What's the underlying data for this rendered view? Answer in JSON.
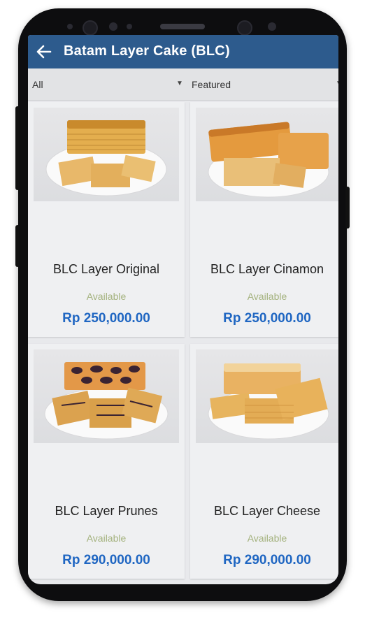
{
  "header": {
    "title": "Batam Layer Cake (BLC)"
  },
  "filters": {
    "category": "All",
    "sort": "Featured"
  },
  "products": [
    {
      "name": "BLC Layer Original",
      "availability": "Available",
      "price": "Rp 250,000.00"
    },
    {
      "name": "BLC Layer Cinamon",
      "availability": "Available",
      "price": "Rp 250,000.00"
    },
    {
      "name": "BLC Layer Prunes",
      "availability": "Available",
      "price": "Rp 290,000.00"
    },
    {
      "name": "BLC Layer Cheese",
      "availability": "Available",
      "price": "Rp 290,000.00"
    }
  ],
  "colors": {
    "app_bar": "#2d5b8d",
    "price": "#1f66c2",
    "availability": "#a4b27e"
  },
  "icons": {
    "back": "arrow-left-icon",
    "dropdown": "caret-down-icon"
  }
}
